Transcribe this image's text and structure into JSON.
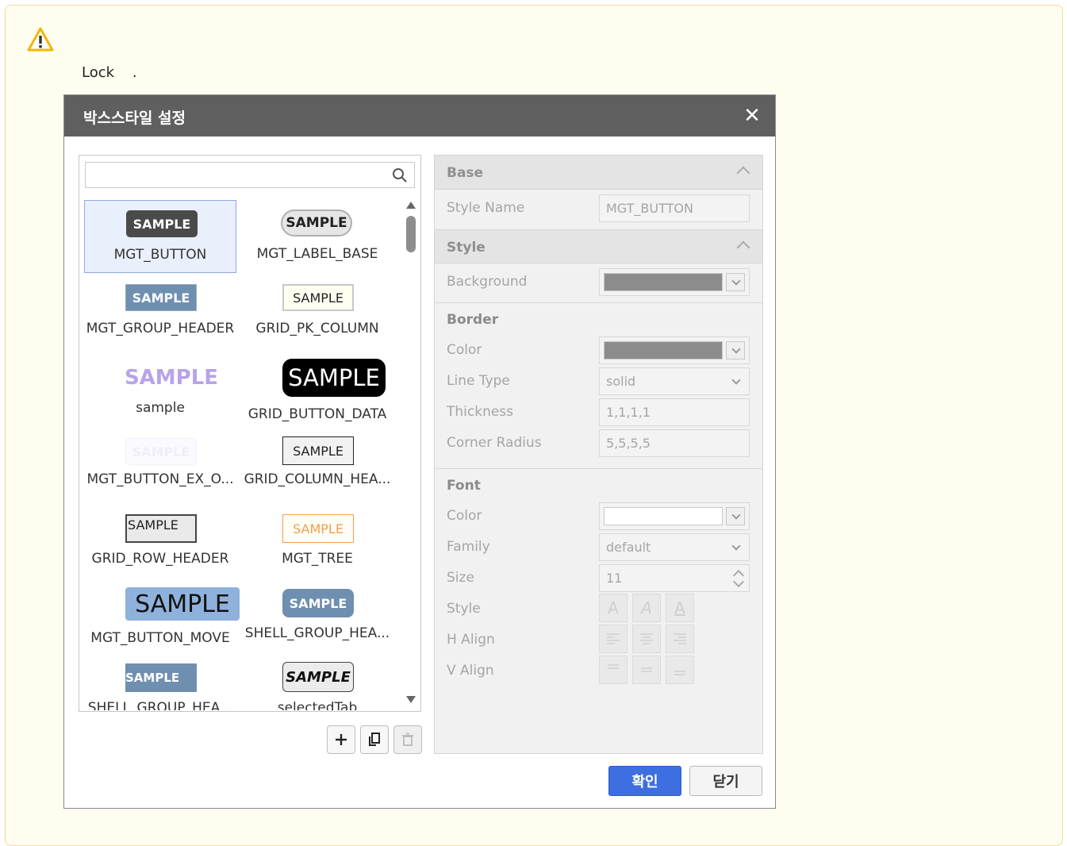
{
  "notice": {
    "icon": "warning-icon",
    "text": "Lock    ."
  },
  "dialog": {
    "title": "박스스타일 설정",
    "close_icon": "close-icon",
    "search": {
      "value": "",
      "placeholder": "",
      "icon": "search-icon"
    },
    "styles": [
      {
        "sample": "SAMPLE",
        "name": "MGT_BUTTON",
        "selected": true
      },
      {
        "sample": "SAMPLE",
        "name": "MGT_LABEL_BASE"
      },
      {
        "sample": "SAMPLE",
        "name": "MGT_GROUP_HEADER"
      },
      {
        "sample": "SAMPLE",
        "name": "GRID_PK_COLUMN"
      },
      {
        "sample": "SAMPLE",
        "name": "sample"
      },
      {
        "sample": "SAMPLE",
        "name": "GRID_BUTTON_DATA"
      },
      {
        "sample": "SAMPLE",
        "name": "MGT_BUTTON_EX_O..."
      },
      {
        "sample": "SAMPLE",
        "name": "GRID_COLUMN_HEA..."
      },
      {
        "sample": "SAMPLE",
        "name": "GRID_ROW_HEADER"
      },
      {
        "sample": "SAMPLE",
        "name": "MGT_TREE"
      },
      {
        "sample": "SAMPLE",
        "name": "MGT_BUTTON_MOVE"
      },
      {
        "sample": "SAMPLE",
        "name": "SHELL_GROUP_HEA..."
      },
      {
        "sample": "SAMPLE",
        "name": "SHELL_GROUP_HEA..."
      },
      {
        "sample": "SAMPLE",
        "name": "selectedTab"
      }
    ],
    "toolbar": {
      "add_icon": "plus-icon",
      "copy_icon": "copy-icon",
      "delete_icon": "trash-icon"
    },
    "properties": {
      "base": {
        "header": "Base",
        "style_name_label": "Style Name",
        "style_name_value": "MGT_BUTTON"
      },
      "style": {
        "header": "Style",
        "background_label": "Background",
        "background_color": "#8c8c8c",
        "border": {
          "header": "Border",
          "color_label": "Color",
          "color_value": "#8c8c8c",
          "line_type_label": "Line Type",
          "line_type_value": "solid",
          "thickness_label": "Thickness",
          "thickness_value": "1,1,1,1",
          "corner_label": "Corner Radius",
          "corner_value": "5,5,5,5"
        },
        "font": {
          "header": "Font",
          "color_label": "Color",
          "color_value": "#ffffff",
          "family_label": "Family",
          "family_value": "default",
          "size_label": "Size",
          "size_value": "11",
          "style_label": "Style",
          "halign_label": "H Align",
          "valign_label": "V Align",
          "style_buttons": [
            "A",
            "A",
            "A"
          ]
        }
      }
    },
    "buttons": {
      "ok": "확인",
      "cancel": "닫기"
    }
  }
}
